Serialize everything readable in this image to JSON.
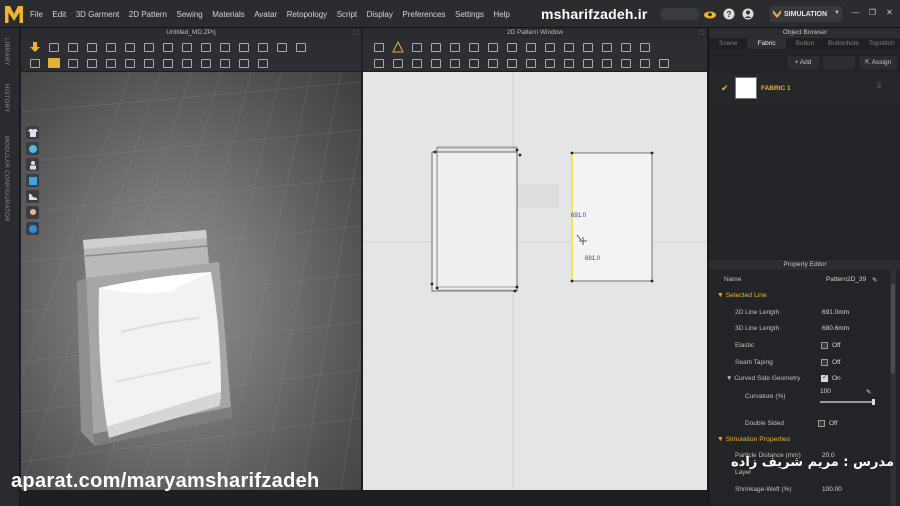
{
  "menubar": {
    "items": [
      "File",
      "Edit",
      "3D Garment",
      "2D Pattern",
      "Sewing",
      "Materials",
      "Avatar",
      "Retopology",
      "Script",
      "Display",
      "Preferences",
      "Settings",
      "Help"
    ],
    "watermark": "msharifzadeh.ir",
    "simulation_label": "SIMULATION"
  },
  "side_strip": {
    "labels": [
      "LIBRARY",
      "HISTORY",
      "MODULAR CONFIGURATOR"
    ]
  },
  "viewport3d": {
    "title": "Untitled_MD.ZPrj"
  },
  "pattern2d": {
    "title": "2D Pattern Window",
    "measure_a": "691.0",
    "measure_b": "691.0"
  },
  "object_browser": {
    "title": "Object Browser",
    "tabs": [
      "Scene",
      "Fabric",
      "Button",
      "Buttonhole",
      "Topstitch"
    ],
    "active_tab": "Fabric",
    "add_label": "+ Add",
    "assign_label": "Assign",
    "fabric_name": "FABRIC 1"
  },
  "property_editor": {
    "title": "Property Editor",
    "name_label": "Name",
    "name_value": "Pattern2D_39",
    "selected_line": "Selected Line",
    "line_2d_label": "2D Line Length",
    "line_2d_value": "691.0mm",
    "line_3d_label": "3D Line Length",
    "line_3d_value": "680.6mm",
    "elastic_label": "Elastic",
    "elastic_value": "Off",
    "seam_label": "Seam Taping",
    "seam_value": "Off",
    "curved_label": "Curved Side Geometry",
    "curved_value": "On",
    "curvature_label": "Curvature (%)",
    "curvature_value": "100",
    "double_label": "Double Sided",
    "double_value": "Off",
    "sim_props": "Simulation Properties",
    "particle_label": "Particle Distance (mm)",
    "particle_value": "20.0",
    "layer_label": "Layer",
    "shrink_label": "Shrinkage-Weft (%)",
    "shrink_value": "100.00"
  },
  "overlay": {
    "aparat": "aparat.com/maryamsharifzadeh",
    "teacher": "مدرس : مریم شریف زاده"
  },
  "colors": {
    "accent": "#f0b32c",
    "selected_line": "#f2e533",
    "measure_text": "#3a3a90"
  }
}
